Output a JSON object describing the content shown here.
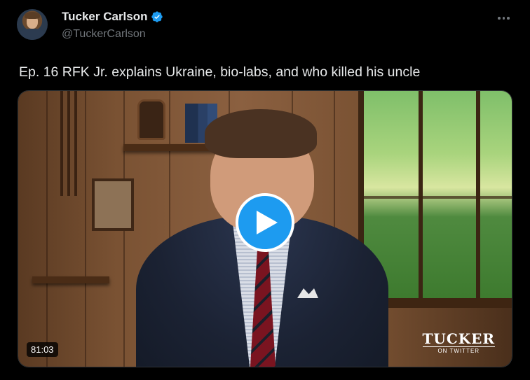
{
  "tweet": {
    "display_name": "Tucker Carlson",
    "handle": "@TuckerCarlson",
    "verified": true,
    "text": "Ep. 16  RFK Jr. explains Ukraine, bio-labs, and who killed his uncle",
    "more_icon": "ellipsis-icon"
  },
  "media": {
    "type": "video",
    "duration": "81:03",
    "play_icon": "play-icon",
    "logo_title": "TUCKER",
    "logo_subtitle": "ON TWITTER"
  },
  "colors": {
    "background": "#000000",
    "accent": "#1d9bf0",
    "text_primary": "#e7e9ea",
    "text_secondary": "#71767b"
  }
}
